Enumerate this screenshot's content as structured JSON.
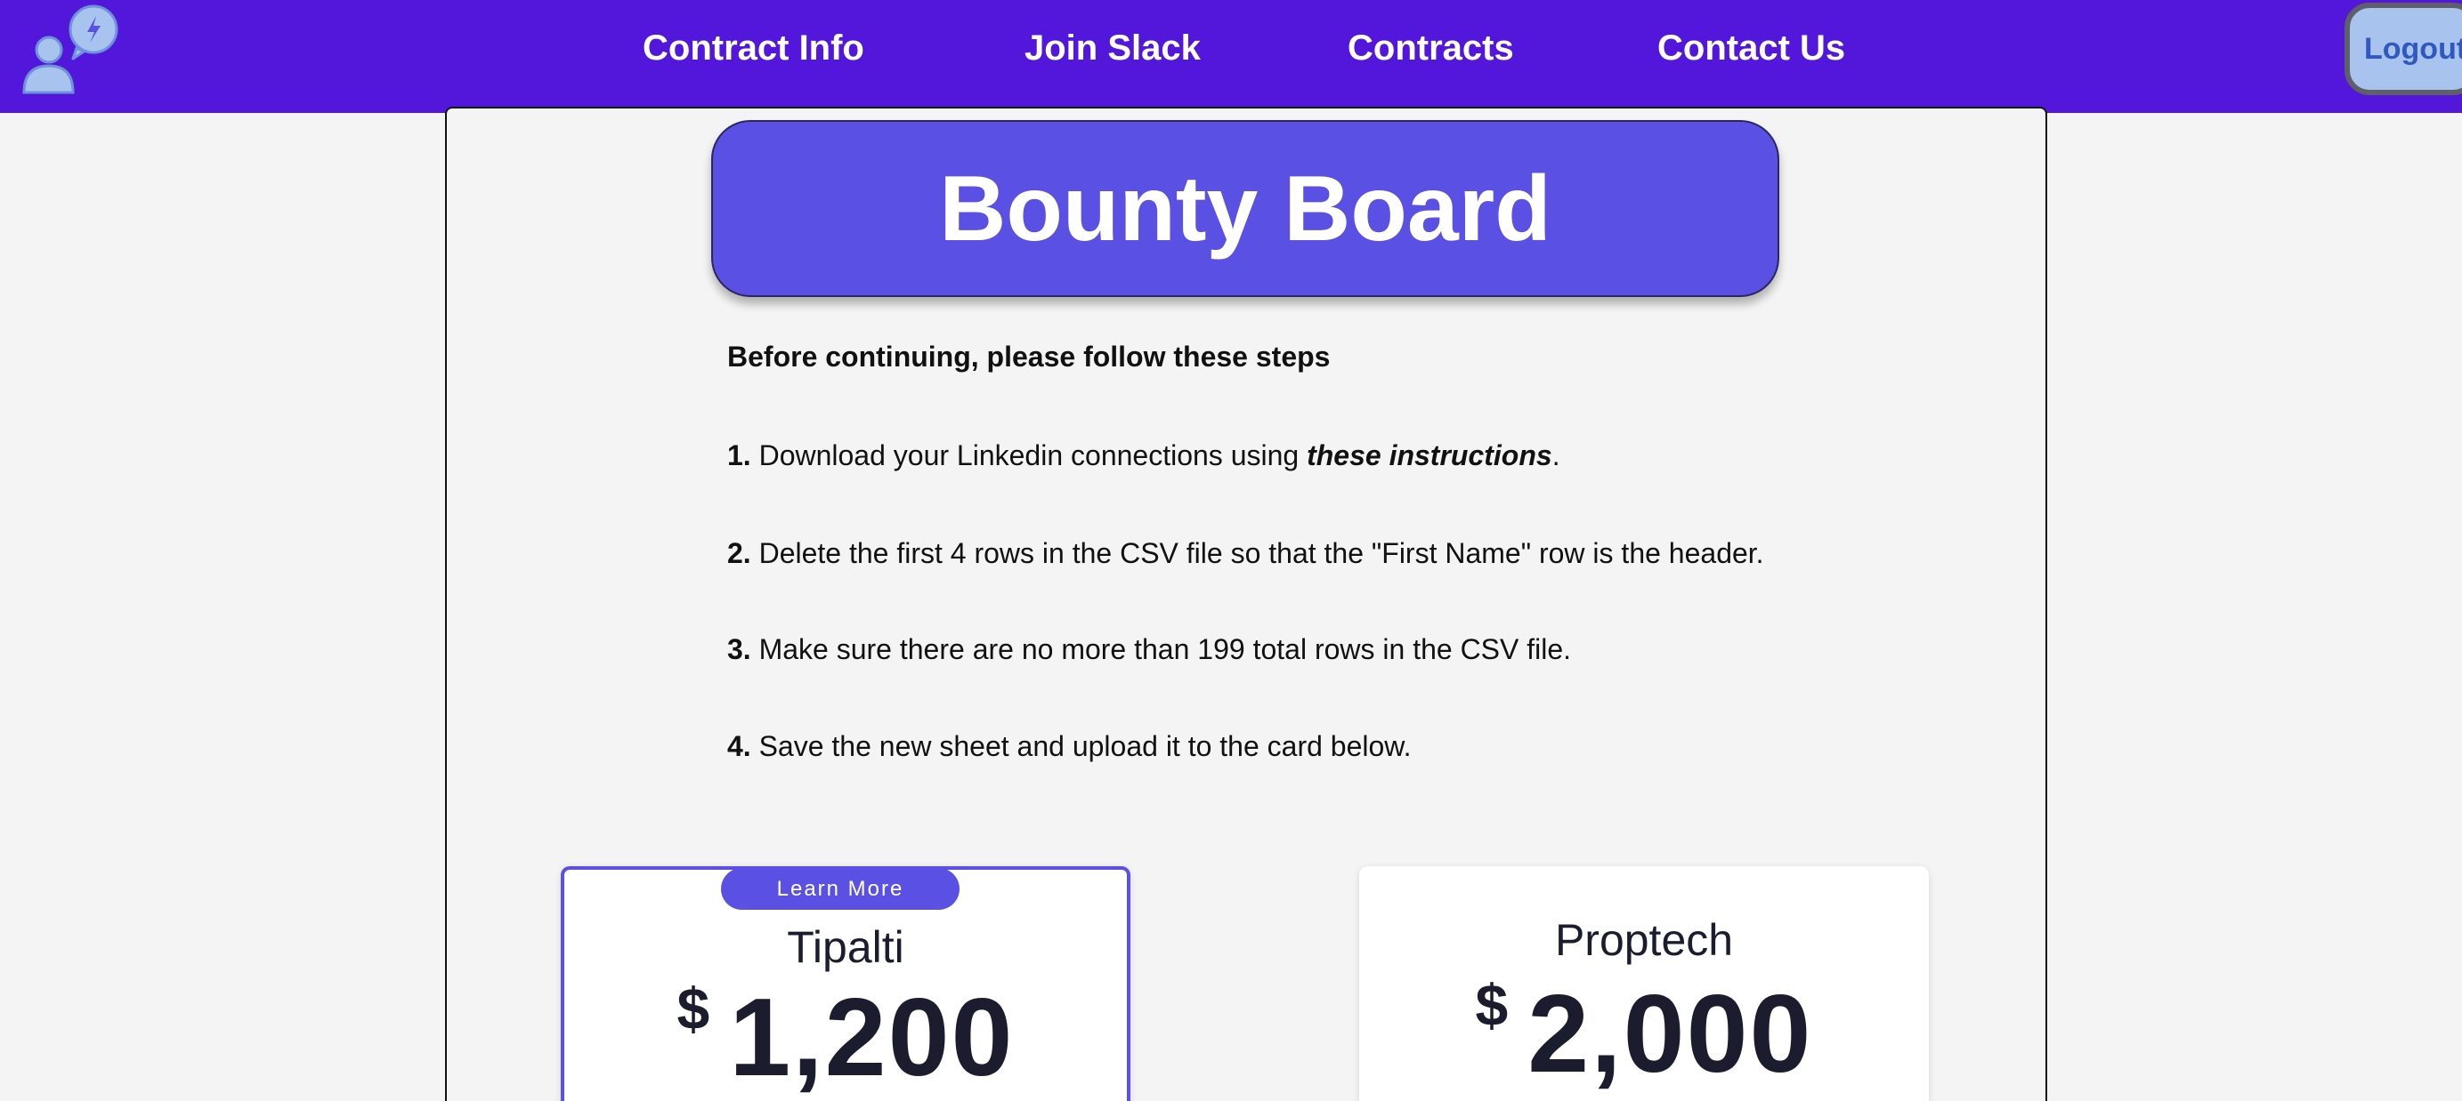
{
  "nav": {
    "links": [
      "Contract Info",
      "Join Slack",
      "Contracts",
      "Contact Us"
    ],
    "logout_label": "Logout"
  },
  "page": {
    "title": "Bounty Board"
  },
  "instructions": {
    "heading": "Before continuing, please follow these steps",
    "steps": [
      {
        "num": "1.",
        "before": " Download your Linkedin connections using ",
        "link": "these instructions",
        "after": "."
      },
      {
        "num": "2.",
        "text": " Delete the first 4 rows in the CSV file so that the \"First Name\" row is the header."
      },
      {
        "num": "3.",
        "text": " Make sure there are no more than 199 total rows in the CSV file."
      },
      {
        "num": "4.",
        "text": " Save the new sheet and upload it to the card below."
      }
    ]
  },
  "cards": [
    {
      "learn_more": "Learn More",
      "name": "Tipalti",
      "currency": "$",
      "amount": "1,200"
    },
    {
      "name": "Proptech",
      "currency": "$",
      "amount": "2,000"
    }
  ],
  "colors": {
    "nav_bg": "#5217db",
    "accent": "#5a51e4",
    "logo": "#a8c4ee"
  }
}
